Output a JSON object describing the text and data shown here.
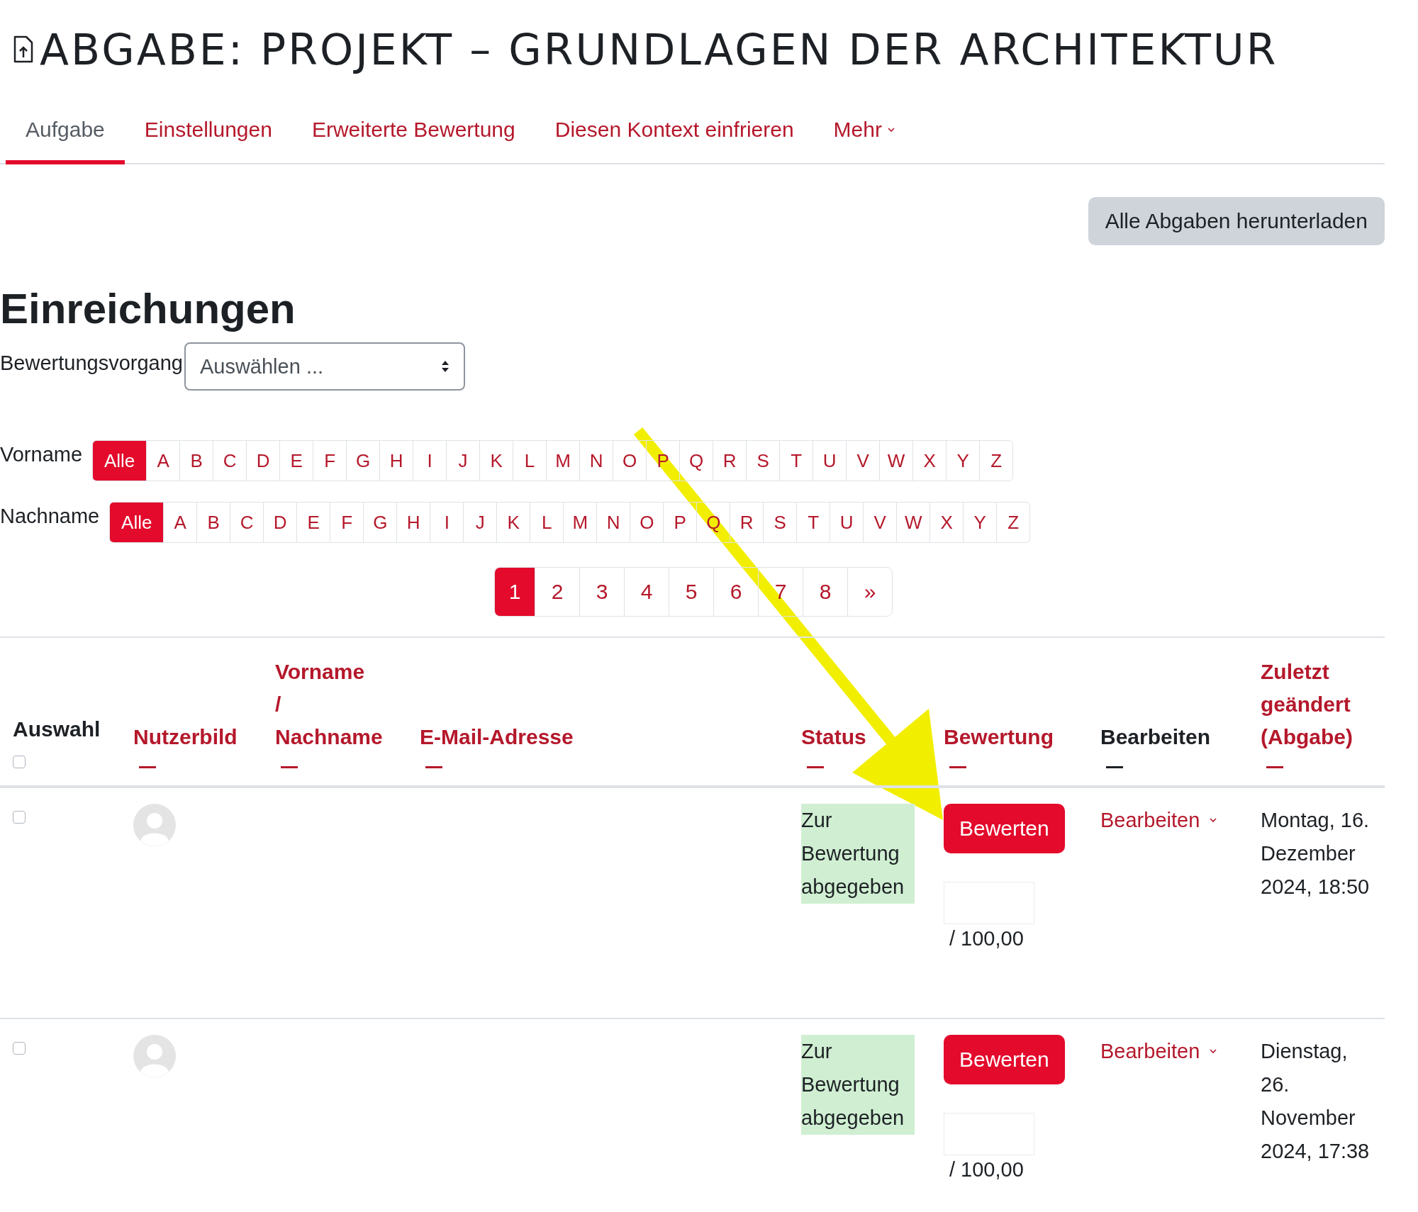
{
  "page_title": "ABGABE: PROJEKT – GRUNDLAGEN DER ARCHITEKTUR",
  "tabs": [
    {
      "label": "Aufgabe",
      "selected": true,
      "kind": "link"
    },
    {
      "label": "Einstellungen",
      "selected": false,
      "kind": "link"
    },
    {
      "label": "Erweiterte Bewertung",
      "selected": false,
      "kind": "link"
    },
    {
      "label": "Diesen Kontext einfrieren",
      "selected": false,
      "kind": "link"
    },
    {
      "label": "Mehr",
      "selected": false,
      "kind": "menu"
    }
  ],
  "download_button": "Alle Abgaben herunterladen",
  "heading": "Einreichungen",
  "grading_action": {
    "label": "Bewertungsvorgang",
    "value": "Auswählen ..."
  },
  "initials_filters": [
    {
      "label": "Vorname",
      "letters": [
        {
          "text": "Alle",
          "selected": true
        },
        {
          "text": "A",
          "selected": false
        },
        {
          "text": "B",
          "selected": false
        },
        {
          "text": "C",
          "selected": false
        },
        {
          "text": "D",
          "selected": false
        },
        {
          "text": "E",
          "selected": false
        },
        {
          "text": "F",
          "selected": false
        },
        {
          "text": "G",
          "selected": false
        },
        {
          "text": "H",
          "selected": false
        },
        {
          "text": "I",
          "selected": false
        },
        {
          "text": "J",
          "selected": false
        },
        {
          "text": "K",
          "selected": false
        },
        {
          "text": "L",
          "selected": false
        },
        {
          "text": "M",
          "selected": false
        },
        {
          "text": "N",
          "selected": false
        },
        {
          "text": "O",
          "selected": false
        },
        {
          "text": "P",
          "selected": false
        },
        {
          "text": "Q",
          "selected": false
        },
        {
          "text": "R",
          "selected": false
        },
        {
          "text": "S",
          "selected": false
        },
        {
          "text": "T",
          "selected": false
        },
        {
          "text": "U",
          "selected": false
        },
        {
          "text": "V",
          "selected": false
        },
        {
          "text": "W",
          "selected": false
        },
        {
          "text": "X",
          "selected": false
        },
        {
          "text": "Y",
          "selected": false
        },
        {
          "text": "Z",
          "selected": false
        }
      ]
    },
    {
      "label": "Nachname",
      "letters": [
        {
          "text": "Alle",
          "selected": true
        },
        {
          "text": "A",
          "selected": false
        },
        {
          "text": "B",
          "selected": false
        },
        {
          "text": "C",
          "selected": false
        },
        {
          "text": "D",
          "selected": false
        },
        {
          "text": "E",
          "selected": false
        },
        {
          "text": "F",
          "selected": false
        },
        {
          "text": "G",
          "selected": false
        },
        {
          "text": "H",
          "selected": false
        },
        {
          "text": "I",
          "selected": false
        },
        {
          "text": "J",
          "selected": false
        },
        {
          "text": "K",
          "selected": false
        },
        {
          "text": "L",
          "selected": false
        },
        {
          "text": "M",
          "selected": false
        },
        {
          "text": "N",
          "selected": false
        },
        {
          "text": "O",
          "selected": false
        },
        {
          "text": "P",
          "selected": false
        },
        {
          "text": "Q",
          "selected": false
        },
        {
          "text": "R",
          "selected": false
        },
        {
          "text": "S",
          "selected": false
        },
        {
          "text": "T",
          "selected": false
        },
        {
          "text": "U",
          "selected": false
        },
        {
          "text": "V",
          "selected": false
        },
        {
          "text": "W",
          "selected": false
        },
        {
          "text": "X",
          "selected": false
        },
        {
          "text": "Y",
          "selected": false
        },
        {
          "text": "Z",
          "selected": false
        }
      ]
    }
  ],
  "pagination": [
    {
      "label": "1",
      "selected": true
    },
    {
      "label": "2",
      "selected": false
    },
    {
      "label": "3",
      "selected": false
    },
    {
      "label": "4",
      "selected": false
    },
    {
      "label": "5",
      "selected": false
    },
    {
      "label": "6",
      "selected": false
    },
    {
      "label": "7",
      "selected": false
    },
    {
      "label": "8",
      "selected": false
    },
    {
      "label": "»",
      "selected": false
    }
  ],
  "table": {
    "columns": [
      {
        "labels": [
          "Auswahl"
        ],
        "kind": "select",
        "sortable": false,
        "checked": false
      },
      {
        "labels": [
          "Nutzerbild"
        ],
        "kind": "plain",
        "sortable": true
      },
      {
        "labels": [
          "Vorname",
          "/",
          "Nachname"
        ],
        "kind": "plain",
        "sortable": true
      },
      {
        "labels": [
          "E-Mail-Adresse"
        ],
        "kind": "plain",
        "sortable": true
      },
      {
        "labels": [
          "Status"
        ],
        "kind": "plain",
        "sortable": true
      },
      {
        "labels": [
          "Bewertung"
        ],
        "kind": "plain",
        "sortable": true
      },
      {
        "labels": [
          "Bearbeiten"
        ],
        "kind": "plain",
        "sortable": false
      },
      {
        "labels": [
          "Zuletzt geändert (Abgabe)"
        ],
        "kind": "plain",
        "sortable": true
      }
    ],
    "rows": [
      {
        "checked": false,
        "status": "Zur Bewertung abgegeben",
        "grade_button": "Bewerten",
        "grade_max": "/ 100,00",
        "edit_menu": "Bearbeiten",
        "modified": "Montag, 16. Dezember 2024, 18:50"
      },
      {
        "checked": false,
        "status": "Zur Bewertung abgegeben",
        "grade_button": "Bewerten",
        "grade_max": "/ 100,00",
        "edit_menu": "Bearbeiten",
        "modified": "Dienstag, 26. November 2024, 17:38"
      }
    ]
  }
}
